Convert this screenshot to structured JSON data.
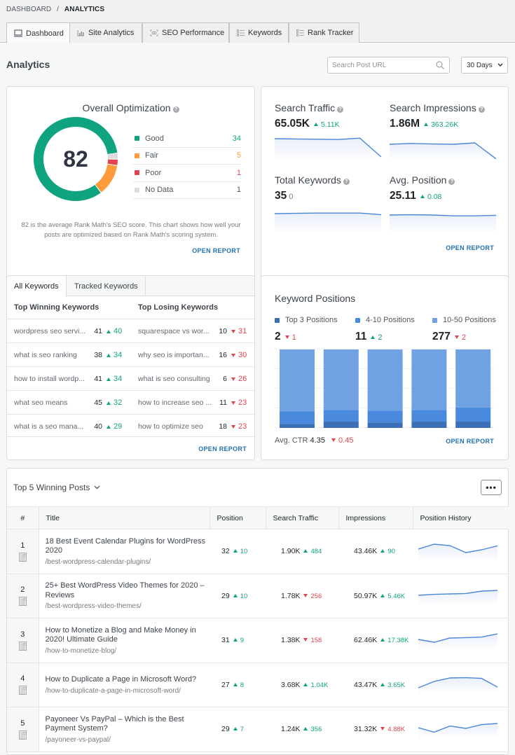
{
  "breadcrumb": {
    "parent": "DASHBOARD",
    "separator": "/",
    "current": "ANALYTICS"
  },
  "tabs": [
    {
      "label": "Dashboard",
      "icon": "monitor-icon",
      "active": true
    },
    {
      "label": "Site Analytics",
      "icon": "bar-chart-icon",
      "active": false
    },
    {
      "label": "SEO Performance",
      "icon": "eye-scan-icon",
      "active": false
    },
    {
      "label": "Keywords",
      "icon": "list-icon",
      "active": false
    },
    {
      "label": "Rank Tracker",
      "icon": "list-icon",
      "active": false
    }
  ],
  "header": {
    "title": "Analytics",
    "search_placeholder": "Search Post URL",
    "range": "30 Days"
  },
  "overall": {
    "title": "Overall Optimization",
    "score": "82",
    "legend": [
      {
        "label": "Good",
        "value": 34,
        "color": "#10a37f"
      },
      {
        "label": "Fair",
        "value": 5,
        "color": "#ff9b3b"
      },
      {
        "label": "Poor",
        "value": 1,
        "color": "#e2454f"
      },
      {
        "label": "No Data",
        "value": 1,
        "color": "#dcdcde"
      }
    ],
    "description": "82 is the average Rank Math's SEO score. This chart shows how well your posts are optimized based on Rank Math's scoring system.",
    "open_report": "OPEN REPORT"
  },
  "stats": {
    "traffic": {
      "label": "Search Traffic",
      "value": "65.05K",
      "delta": "5.11K",
      "dir": "up",
      "trend": [
        0.8,
        0.79,
        0.78,
        0.77,
        0.82,
        0.15
      ]
    },
    "impressions": {
      "label": "Search Impressions",
      "value": "1.86M",
      "delta": "363.26K",
      "dir": "up",
      "trend": [
        0.6,
        0.63,
        0.61,
        0.6,
        0.65,
        0.08
      ]
    },
    "keywords": {
      "label": "Total Keywords",
      "value": "35",
      "delta": "0",
      "dir": "none",
      "trend": [
        0.7,
        0.71,
        0.72,
        0.72,
        0.72,
        0.66
      ]
    },
    "position": {
      "label": "Avg. Position",
      "value": "25.11",
      "delta": "0.08",
      "dir": "up",
      "trend": [
        0.65,
        0.66,
        0.65,
        0.62,
        0.62,
        0.64
      ]
    },
    "open_report": "OPEN REPORT"
  },
  "keywords": {
    "tabs": [
      "All Keywords",
      "Tracked Keywords"
    ],
    "winning_title": "Top Winning Keywords",
    "losing_title": "Top Losing Keywords",
    "winning": [
      {
        "name": "wordpress seo servi...",
        "pos": "41",
        "delta": "40"
      },
      {
        "name": "what is seo ranking",
        "pos": "38",
        "delta": "34"
      },
      {
        "name": "how to install wordp...",
        "pos": "41",
        "delta": "34"
      },
      {
        "name": "what seo means",
        "pos": "45",
        "delta": "32"
      },
      {
        "name": "what is a seo mana...",
        "pos": "40",
        "delta": "29"
      }
    ],
    "losing": [
      {
        "name": "squarespace vs wor...",
        "pos": "10",
        "delta": "31"
      },
      {
        "name": "why seo is importan...",
        "pos": "16",
        "delta": "30"
      },
      {
        "name": "what is seo consulting",
        "pos": "6",
        "delta": "26"
      },
      {
        "name": "how to increase seo ...",
        "pos": "11",
        "delta": "23"
      },
      {
        "name": "how to optimize seo",
        "pos": "18",
        "delta": "23"
      }
    ],
    "open_report": "OPEN REPORT"
  },
  "positions": {
    "title": "Keyword Positions",
    "groups": [
      {
        "label": "Top 3 Positions",
        "value": "2",
        "delta": "1",
        "dir": "down",
        "color": "#3d6fb6"
      },
      {
        "label": "4-10 Positions",
        "value": "11",
        "delta": "2",
        "dir": "up",
        "color": "#4a8ade"
      },
      {
        "label": "10-50 Positions",
        "value": "277",
        "delta": "2",
        "dir": "down",
        "color": "#6fa1e3"
      }
    ],
    "ctr_label": "Avg. CTR",
    "ctr_value": "4.35",
    "ctr_delta": "0.45",
    "open_report": "OPEN REPORT"
  },
  "chart_data": {
    "type": "bar",
    "stacked": true,
    "normalized": true,
    "categories": [
      "1",
      "2",
      "3",
      "4",
      "5"
    ],
    "series": [
      {
        "name": "Top 3 Positions",
        "values": [
          0.05,
          0.08,
          0.07,
          0.08,
          0.08
        ]
      },
      {
        "name": "4-10 Positions",
        "values": [
          0.16,
          0.15,
          0.15,
          0.15,
          0.18
        ]
      },
      {
        "name": "10-50 Positions",
        "values": [
          0.79,
          0.77,
          0.78,
          0.77,
          0.74
        ]
      }
    ],
    "ylim": [
      0,
      1
    ],
    "grid": true
  },
  "posts": {
    "title": "Top 5 Winning Posts",
    "more_label": "•••",
    "columns": [
      "#",
      "Title",
      "Position",
      "Search Traffic",
      "Impressions",
      "Position History"
    ],
    "rows": [
      {
        "n": "1",
        "title": "18 Best Event Calendar Plugins for WordPress 2020",
        "url": "/best-wordpress-calendar-plugins/",
        "pos": "32",
        "pos_d": "10",
        "pos_dir": "up",
        "tr": "1.90K",
        "tr_d": "484",
        "tr_dir": "up",
        "imp": "43.46K",
        "imp_d": "90",
        "imp_dir": "up",
        "hist": [
          0.55,
          0.9,
          0.8,
          0.3,
          0.5,
          0.78
        ]
      },
      {
        "n": "2",
        "title": "25+ Best WordPress Video Themes for 2020 – Reviews",
        "url": "/best-wordpress-video-themes/",
        "pos": "29",
        "pos_d": "10",
        "pos_dir": "up",
        "tr": "1.78K",
        "tr_d": "256",
        "tr_dir": "down",
        "imp": "50.97K",
        "imp_d": "5.46K",
        "imp_dir": "up",
        "hist": [
          0.4,
          0.47,
          0.5,
          0.53,
          0.7,
          0.75
        ]
      },
      {
        "n": "3",
        "title": "How to Monetize a Blog and Make Money in 2020! Ultimate Guide",
        "url": "/how-to-monetize-blog/",
        "pos": "31",
        "pos_d": "9",
        "pos_dir": "up",
        "tr": "1.38K",
        "tr_d": "158",
        "tr_dir": "down",
        "imp": "62.46K",
        "imp_d": "17.38K",
        "imp_dir": "up",
        "hist": [
          0.45,
          0.25,
          0.55,
          0.58,
          0.62,
          0.85
        ]
      },
      {
        "n": "4",
        "title": "How to Duplicate a Page in Microsoft Word?",
        "url": "/how-to-duplicate-a-page-in-microsoft-word/",
        "pos": "27",
        "pos_d": "8",
        "pos_dir": "up",
        "tr": "3.68K",
        "tr_d": "1.04K",
        "tr_dir": "up",
        "imp": "43.47K",
        "imp_d": "3.65K",
        "imp_dir": "up",
        "hist": [
          0.15,
          0.6,
          0.85,
          0.87,
          0.82,
          0.2
        ]
      },
      {
        "n": "5",
        "title": "Payoneer Vs PayPal – Which is the Best Payment System?",
        "url": "/payoneer-vs-paypal/",
        "pos": "29",
        "pos_d": "7",
        "pos_dir": "up",
        "tr": "1.24K",
        "tr_d": "356",
        "tr_dir": "up",
        "imp": "31.32K",
        "imp_d": "4.88K",
        "imp_dir": "down",
        "hist": [
          0.5,
          0.18,
          0.62,
          0.45,
          0.72,
          0.8
        ]
      }
    ]
  }
}
